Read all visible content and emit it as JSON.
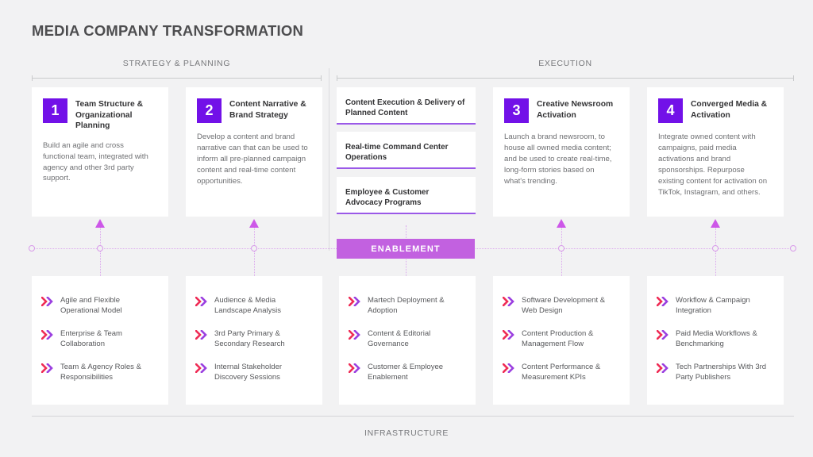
{
  "header": {
    "title": "MEDIA COMPANY TRANSFORMATION"
  },
  "phases": [
    {
      "label": "STRATEGY & PLANNING"
    },
    {
      "label": "EXECUTION"
    }
  ],
  "footer": {
    "label": "INFRASTRUCTURE"
  },
  "enablement": {
    "label": "ENABLEMENT",
    "bar_color": "#c261e0",
    "connector_color": "#dba8ee",
    "arrow_color": "#cd57e8"
  },
  "theme": {
    "page_background": "#f2f2f3",
    "card_background": "#ffffff",
    "badge_purple": "#7211e8",
    "underline_purple": "#9b59e8",
    "title_gray": "#4d4d4f",
    "body_gray": "#6e6f72",
    "chevron_pink": "#ef2d56",
    "chevron_purple": "#9b3fe0"
  },
  "pillars": [
    {
      "number": "1",
      "title": "Team Structure & Organizational Planning",
      "body": "Build an agile and cross functional team, integrated with agency and other 3rd party support."
    },
    {
      "number": "2",
      "title": "Content Narrative & Brand Strategy",
      "body": "Develop a content and brand narrative can  that can be used to inform all pre-planned campaign content and real-time content opportunities."
    },
    {
      "number": "3",
      "title": "Creative Newsroom Activation",
      "body": "Launch a brand newsroom, to house all owned media content; and be used to create real-time, long-form stories based on what's trending."
    },
    {
      "number": "4",
      "title": "Converged Media & Activation",
      "body": "Integrate owned content with campaigns, paid media activations and brand sponsorships. Repurpose existing  content for activation on TikTok, Instagram, and others."
    }
  ],
  "deliverables": [
    {
      "label": "Content Execution & Delivery of Planned Content"
    },
    {
      "label": "Real-time Command Center Operations"
    },
    {
      "label": "Employee & Customer Advocacy Programs"
    }
  ],
  "enablers": [
    {
      "items": [
        "Agile and Flexible Operational Model",
        "Enterprise & Team Collaboration",
        "Team & Agency Roles & Responsibilities"
      ]
    },
    {
      "items": [
        "Audience & Media Landscape Analysis",
        "3rd Party Primary & Secondary Research",
        "Internal Stakeholder Discovery Sessions"
      ]
    },
    {
      "items": [
        "Martech Deployment & Adoption",
        "Content & Editorial Governance",
        "Customer & Employee Enablement"
      ]
    },
    {
      "items": [
        "Software Development & Web Design",
        "Content Production & Management Flow",
        "Content Performance & Measurement KPIs"
      ]
    },
    {
      "items": [
        "Workflow & Campaign Integration",
        "Paid Media Workflows & Benchmarking",
        "Tech Partnerships With 3rd Party Publishers"
      ]
    }
  ]
}
